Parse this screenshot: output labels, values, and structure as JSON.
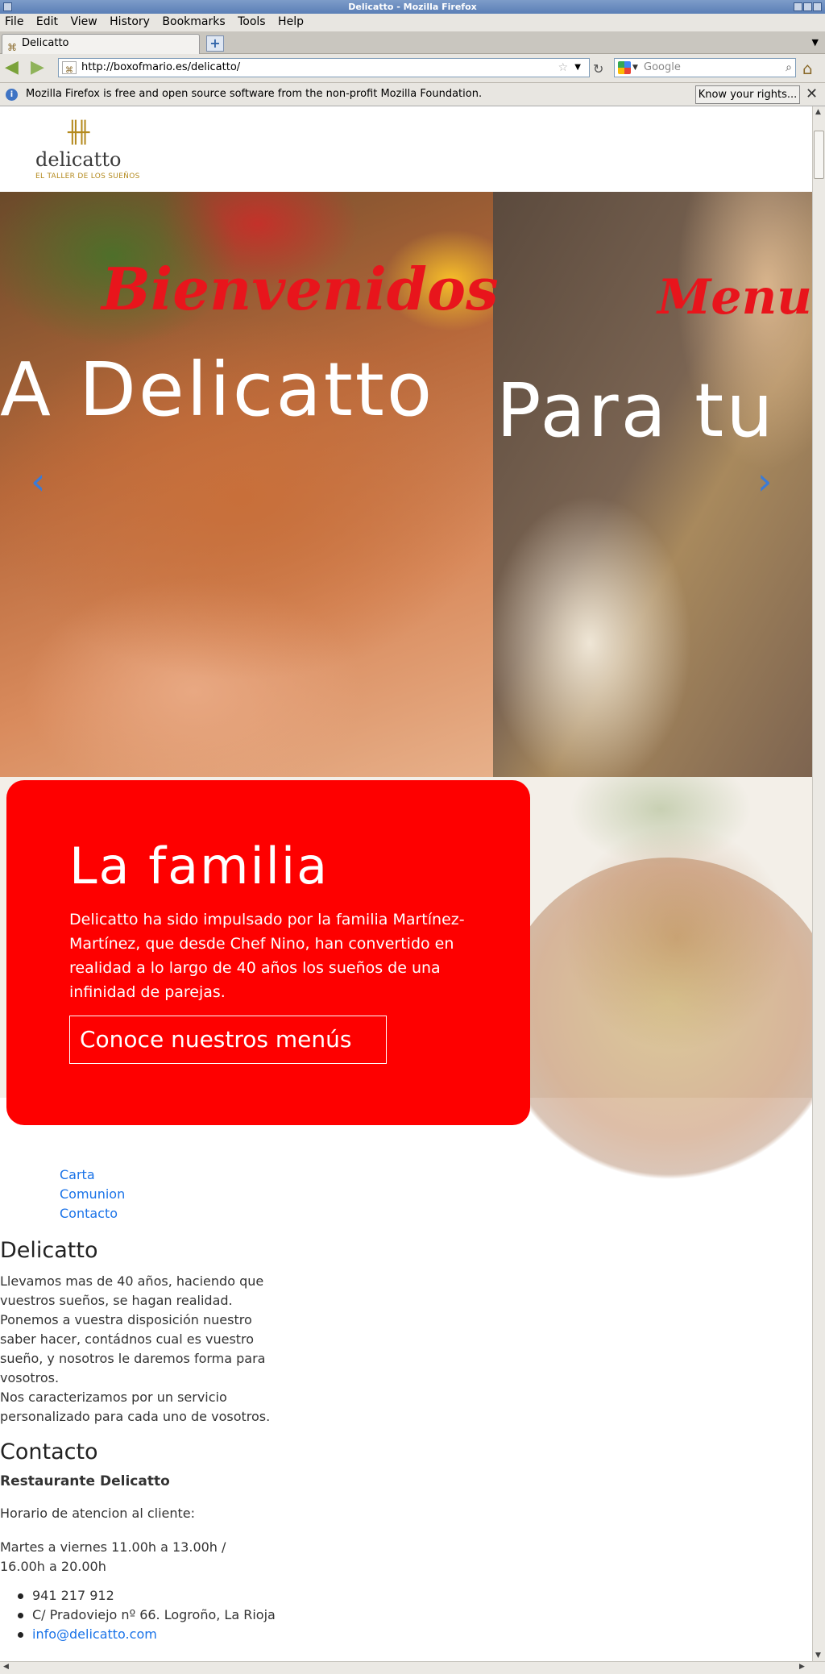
{
  "window": {
    "title": "Delicatto - Mozilla Firefox"
  },
  "menu": [
    "File",
    "Edit",
    "View",
    "History",
    "Bookmarks",
    "Tools",
    "Help"
  ],
  "tab": {
    "label": "Delicatto"
  },
  "nav": {
    "url": "http://boxofmario.es/delicatto/",
    "search_placeholder": "Google"
  },
  "infobar": {
    "message": "Mozilla Firefox is free and open source software from the non-profit Mozilla Foundation.",
    "button": "Know your rights..."
  },
  "logo": {
    "name": "delicatto",
    "tagline": "EL TALLER DE LOS SUEÑOS"
  },
  "hero": {
    "slides": [
      {
        "script": "Bienvenidos",
        "title": "A Delicatto"
      },
      {
        "script": "Menus",
        "title": "Para tu"
      }
    ]
  },
  "familia": {
    "title": "La familia",
    "text": "Delicatto ha sido impulsado por la familia Martínez-Martínez, que desde Chef Nino, han convertido en realidad a lo largo de 40 años los sueños de una infinidad de parejas.",
    "button": "Conoce nuestros menús"
  },
  "links": [
    "Carta",
    "Comunion",
    "Contacto"
  ],
  "about": {
    "heading": "Delicatto",
    "text": "Llevamos mas de 40 años, haciendo que vuestros sueños, se hagan realidad. Ponemos a vuestra disposición nuestro saber hacer, contádnos cual es vuestro sueño, y nosotros le daremos forma para vosotros.\nNos caracterizamos por un servicio personalizado para cada uno de vosotros."
  },
  "contact": {
    "heading": "Contacto",
    "name": "Restaurante Delicatto",
    "hours_label": "Horario de atencion al cliente:",
    "hours": "Martes a viernes 11.00h a 13.00h / 16.00h a 20.00h",
    "phone": "941 217 912",
    "address": "C/ Pradoviejo nº 66. Logroño, La Rioja",
    "email": "info@delicatto.com"
  },
  "colors": {
    "accent": "#fe0000",
    "link": "#1a73e8",
    "script": "#e8151c"
  }
}
